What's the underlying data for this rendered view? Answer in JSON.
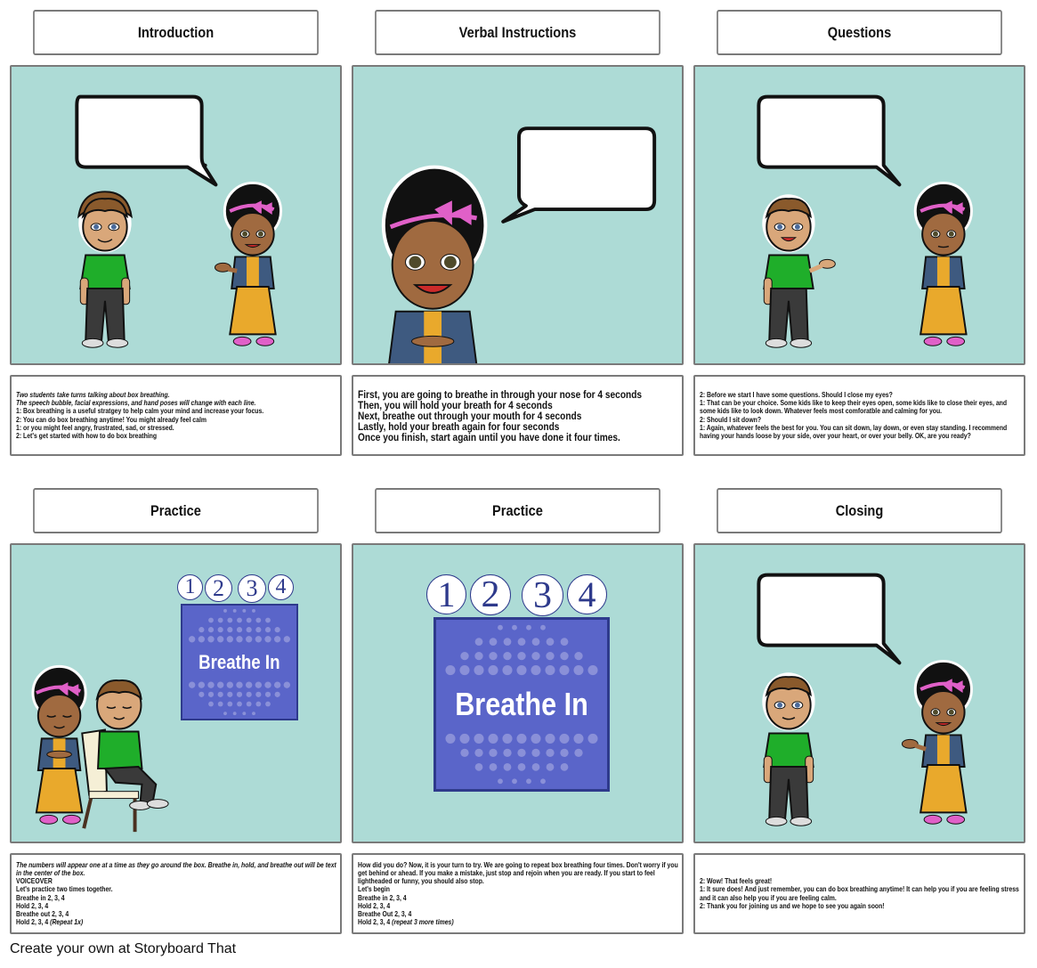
{
  "storyboard": {
    "rows": [
      {
        "cells": [
          {
            "title": "Introduction",
            "scene": "two-students-talking",
            "text_style": "small",
            "lines": [
              {
                "text": "Two students take turns talking about box breathing.",
                "italic": true
              },
              {
                "text": "The speech bubble, facial expressions, and hand poses will change with each line.",
                "italic": true
              },
              {
                "text": "1: Box breathing is a useful stratgey to help calm your mind and increase your focus.",
                "italic": false
              },
              {
                "text": "2: You can do box breathing anytime! You might already feel calm",
                "italic": false
              },
              {
                "text": "1: or you might feel angry, frustrated, sad, or stressed.",
                "italic": false
              },
              {
                "text": "2: Let's get started with how to do box breathing",
                "italic": false
              }
            ]
          },
          {
            "title": "Verbal Instructions",
            "scene": "girl-closeup-speaking",
            "text_style": "medium",
            "lines": [
              {
                "text": "First, you are going to breathe in through your nose for 4 seconds",
                "italic": false
              },
              {
                "text": "Then, you will hold your breath for 4 seconds",
                "italic": false
              },
              {
                "text": "Next, breathe out through your mouth for 4 seconds",
                "italic": false
              },
              {
                "text": "Lastly, hold your breath again for four seconds",
                "italic": false
              },
              {
                "text": "Once you finish, start again until you have done it four times.",
                "italic": false
              }
            ]
          },
          {
            "title": "Questions",
            "scene": "two-students-boy-speaking",
            "text_style": "small-wrap",
            "lines": [
              {
                "text": "2: Before we start I have some questions. Should I close my eyes?",
                "italic": false
              },
              {
                "text": "1: That can be your choice. Some kids like to keep their eyes open, some kids like to close their eyes, and some kids like to look down. Whatever feels most comforatble and calming for you.",
                "italic": false
              },
              {
                "text": "2: Should I sit down?",
                "italic": false
              },
              {
                "text": "1: Again, whatever feels the best for you. You can sit down, lay down, or even stay standing. I recommend having your hands loose by your side, over your heart, or over your belly. OK, are you ready?",
                "italic": false
              }
            ]
          }
        ]
      },
      {
        "cells": [
          {
            "title": "Practice",
            "scene": "students-eyes-closed-with-box",
            "text_style": "small-wrap",
            "box": {
              "numbers": [
                "1",
                "2",
                "3",
                "4"
              ],
              "label": "Breathe In"
            },
            "lines": [
              {
                "text": "The numbers will appear one at a time as they go around the box. Breathe in, hold, and breathe out will be text in the center of the box.",
                "italic": true
              },
              {
                "text": "VOICEOVER",
                "italic": false
              },
              {
                "text": "Let's practice two times together.",
                "italic": false
              },
              {
                "text": "Breathe in 2, 3, 4",
                "italic": false
              },
              {
                "text": "Hold 2, 3, 4",
                "italic": false
              },
              {
                "text": "Breathe out 2, 3, 4",
                "italic": false
              },
              {
                "text": "Hold 2, 3, 4 ",
                "italic": false,
                "suffix_italic": "(Repeat 1x)"
              }
            ]
          },
          {
            "title": "Practice",
            "scene": "large-breathe-box",
            "text_style": "small-wrap",
            "box": {
              "numbers": [
                "1",
                "2",
                "3",
                "4"
              ],
              "label": "Breathe In"
            },
            "lines": [
              {
                "text": "How did you do? Now, it is your turn to try. We are going to repeat box breathing four times. Don't worry if you get behind or ahead. If you make a mistake, just stop and rejoin when you are ready. If you start to feel lightheaded or funny, you should also stop.",
                "italic": false
              },
              {
                "text": "Let's begin",
                "italic": false
              },
              {
                "text": "Breathe in 2, 3, 4",
                "italic": false
              },
              {
                "text": "Hold 2, 3, 4",
                "italic": false
              },
              {
                "text": "Breathe Out 2, 3, 4",
                "italic": false
              },
              {
                "text": "Hold 2, 3, 4 ",
                "italic": false,
                "suffix_italic": "(repeat 3 more times)"
              }
            ]
          },
          {
            "title": "Closing",
            "scene": "two-students-girl-speaking",
            "text_style": "small-wrap",
            "lines": [
              {
                "text": "2: Wow! That feels great!",
                "italic": false
              },
              {
                "text": "1: It sure does! And just remember, you can do box breathing anytime! It can help you if you are feeling stress and it can also help you if you are feeling calm.",
                "italic": false
              },
              {
                "text": "2: Thank you for joining us and we hope to see you again soon!",
                "italic": false
              }
            ]
          }
        ]
      }
    ]
  },
  "footer": {
    "text": "Create your own at Storyboard That"
  },
  "colors": {
    "scene_bg": "#addbd6",
    "box_fill": "#5a65c9",
    "box_border": "#2e3a8c",
    "boy_shirt": "#1fae2a",
    "girl_skirt": "#e9a92c",
    "girl_jacket": "#3e5a80",
    "bow": "#e060c8"
  }
}
